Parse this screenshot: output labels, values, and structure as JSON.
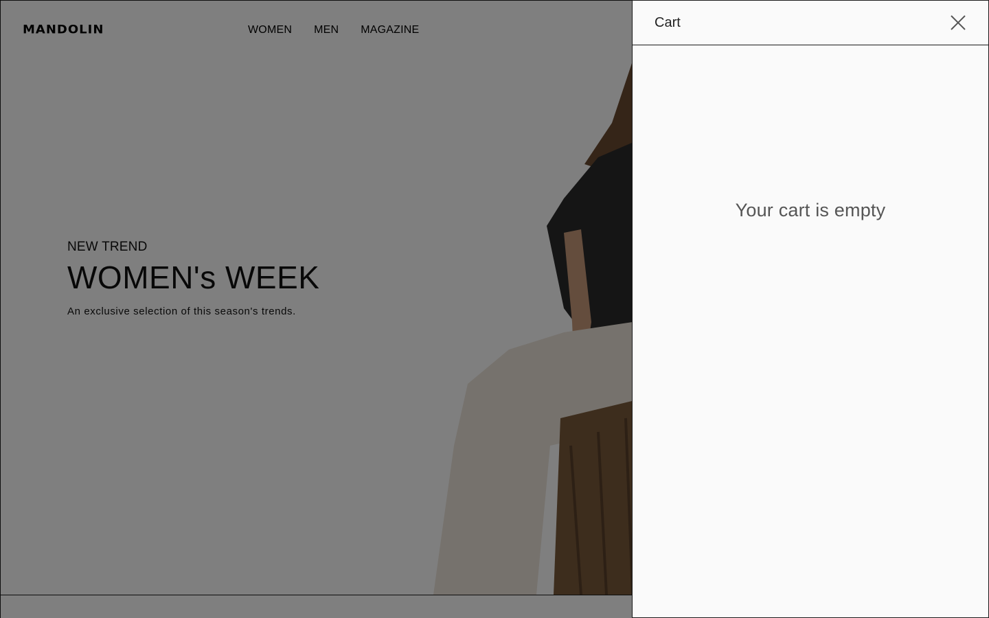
{
  "site": {
    "logo": "MANDOLIN",
    "nav": [
      "WOMEN",
      "MEN",
      "MAGAZINE"
    ]
  },
  "hero": {
    "eyebrow": "NEW TREND",
    "title": "WOMEN's WEEK",
    "description": "An exclusive selection of this season's trends."
  },
  "cart": {
    "title": "Cart",
    "empty_message": "Your cart is empty",
    "close_icon": "close-icon"
  },
  "colors": {
    "overlay": "#808080",
    "drawer_bg": "#fafafa",
    "border": "#1a1a1a"
  }
}
